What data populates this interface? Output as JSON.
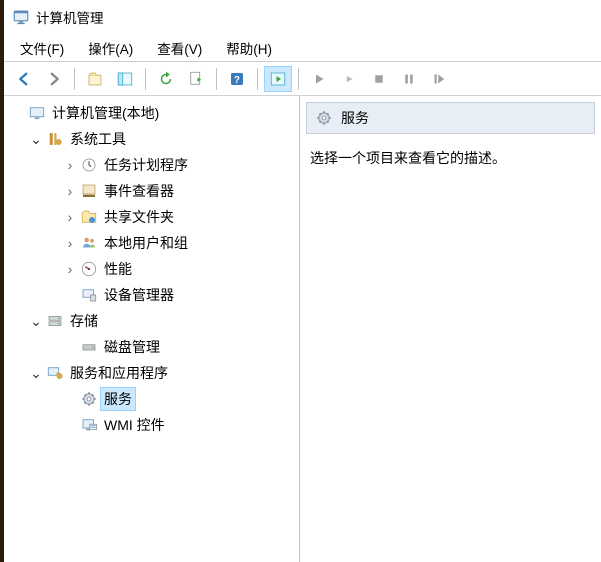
{
  "titlebar": {
    "title": "计算机管理"
  },
  "menubar": {
    "file": "文件(F)",
    "action": "操作(A)",
    "view": "查看(V)",
    "help": "帮助(H)"
  },
  "tree": {
    "root": "计算机管理(本地)",
    "system_tools": "系统工具",
    "task_scheduler": "任务计划程序",
    "event_viewer": "事件查看器",
    "shared_folders": "共享文件夹",
    "local_users": "本地用户和组",
    "performance": "性能",
    "device_manager": "设备管理器",
    "storage": "存储",
    "disk_management": "磁盘管理",
    "services_apps": "服务和应用程序",
    "services": "服务",
    "wmi": "WMI 控件"
  },
  "detail": {
    "header": "服务",
    "body": "选择一个项目来查看它的描述。"
  }
}
